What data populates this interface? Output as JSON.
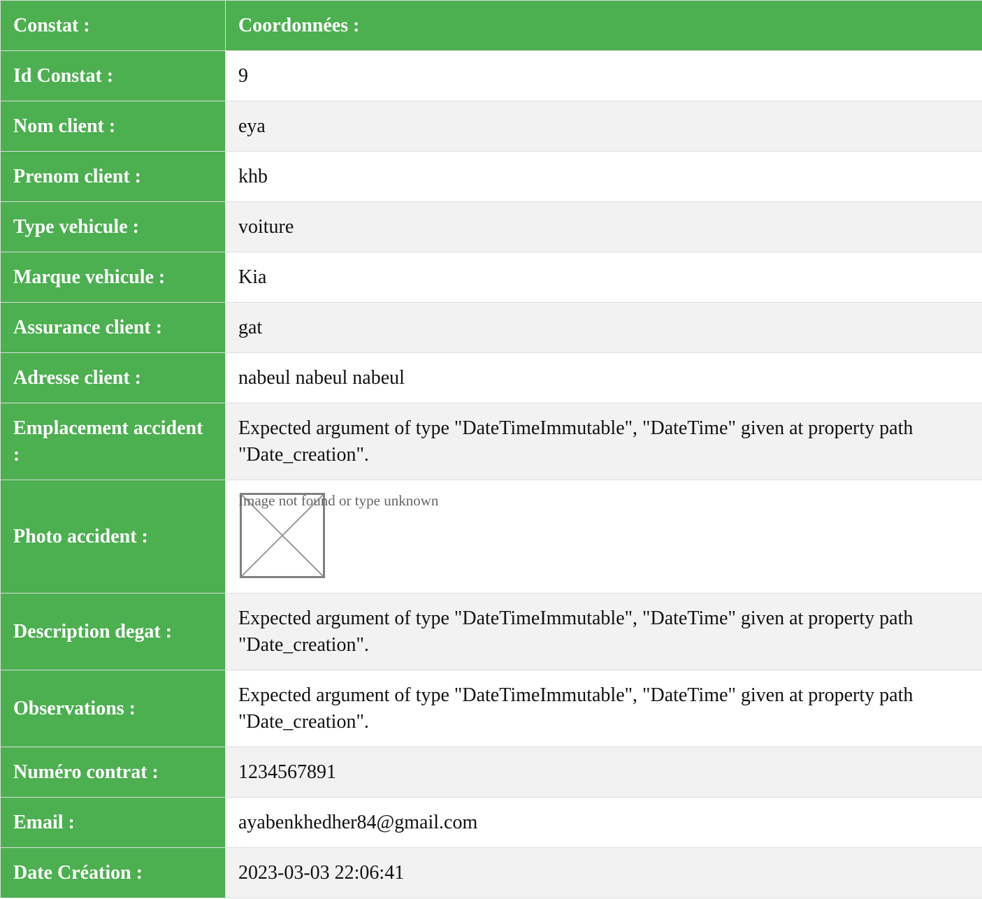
{
  "header": {
    "label_col": "Constat :",
    "value_col": "Coordonnées :"
  },
  "rows": [
    {
      "label": "Id Constat :",
      "value": "9"
    },
    {
      "label": "Nom client :",
      "value": "eya"
    },
    {
      "label": "Prenom client :",
      "value": "khb"
    },
    {
      "label": "Type vehicule :",
      "value": "voiture"
    },
    {
      "label": "Marque vehicule :",
      "value": "Kia"
    },
    {
      "label": "Assurance client :",
      "value": "gat"
    },
    {
      "label": "Adresse client :",
      "value": "nabeul nabeul nabeul"
    },
    {
      "label": "Emplacement accident :",
      "value": "Expected argument of type \"DateTimeImmutable\", \"DateTime\" given at property path \"Date_creation\"."
    },
    {
      "label": "Photo accident :",
      "value": "Image not found or type unknown",
      "icon": "broken-image-icon"
    },
    {
      "label": "Description degat :",
      "value": "Expected argument of type \"DateTimeImmutable\", \"DateTime\" given at property path \"Date_creation\"."
    },
    {
      "label": "Observations :",
      "value": "Expected argument of type \"DateTimeImmutable\", \"DateTime\" given at property path \"Date_creation\"."
    },
    {
      "label": "Numéro contrat :",
      "value": "1234567891"
    },
    {
      "label": "Email :",
      "value": "ayabenkhedher84@gmail.com"
    },
    {
      "label": "Date Création :",
      "value": "2023-03-03 22:06:41"
    }
  ],
  "colors": {
    "header_green": "#4caf50",
    "border": "#dddddd",
    "row_alt": "#f2f2f2"
  }
}
